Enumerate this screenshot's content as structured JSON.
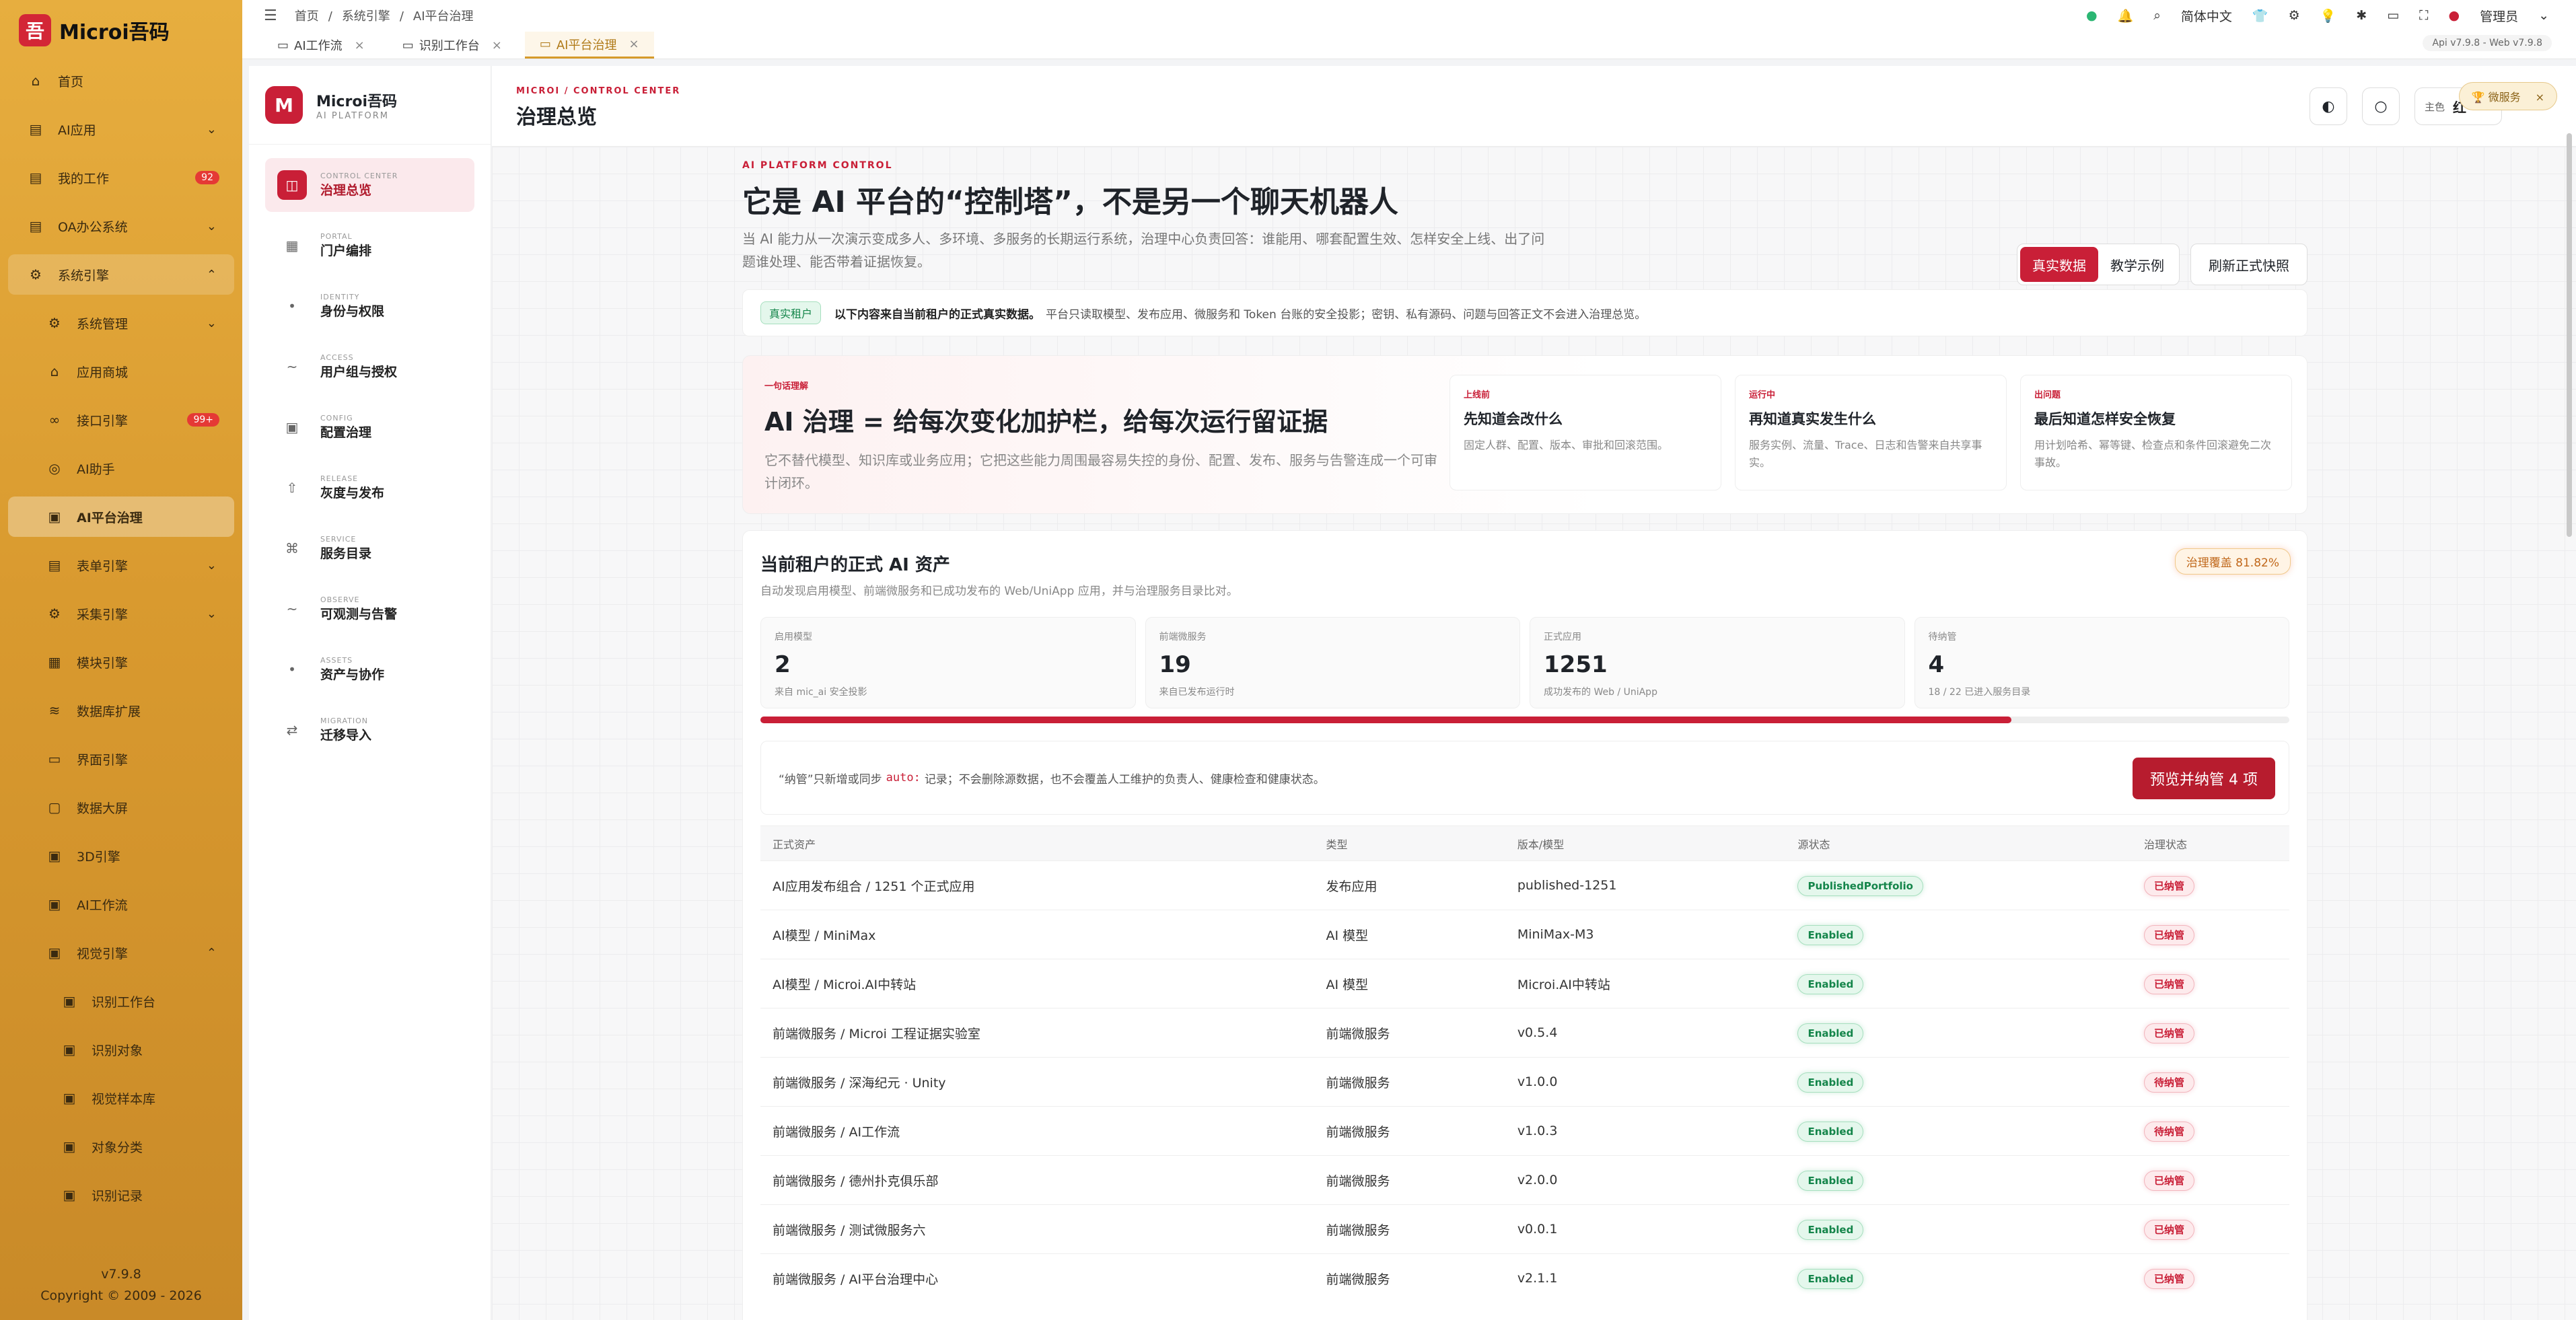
{
  "app": {
    "name": "Microi吾码",
    "version": "v7.9.8",
    "copyright": "Copyright © 2009 - 2026"
  },
  "sidebar": {
    "items": [
      {
        "label": "首页",
        "icon": "home-icon"
      },
      {
        "label": "AI应用",
        "icon": "doc-icon",
        "chevron": "⌄"
      },
      {
        "label": "我的工作",
        "icon": "doc-icon",
        "badge": "92"
      },
      {
        "label": "OA办公系统",
        "icon": "doc-icon",
        "chevron": "⌄"
      },
      {
        "label": "系统引擎",
        "icon": "gear-icon",
        "chevron": "⌃"
      },
      {
        "label": "系统管理",
        "icon": "gear-icon",
        "chevron": "⌄"
      },
      {
        "label": "应用商城",
        "icon": "home-icon"
      },
      {
        "label": "接口引擎",
        "icon": "link-icon",
        "badge": "99+"
      },
      {
        "label": "AI助手",
        "icon": "ai-icon"
      },
      {
        "label": "AI平台治理",
        "icon": "clipboard-icon"
      },
      {
        "label": "表单引擎",
        "icon": "doc-icon",
        "chevron": "⌄"
      },
      {
        "label": "采集引擎",
        "icon": "gear-icon",
        "chevron": "⌄"
      },
      {
        "label": "模块引擎",
        "icon": "grid-icon"
      },
      {
        "label": "数据库扩展",
        "icon": "database-icon"
      },
      {
        "label": "界面引擎",
        "icon": "layout-icon"
      },
      {
        "label": "数据大屏",
        "icon": "monitor-icon"
      },
      {
        "label": "3D引擎",
        "icon": "clipboard-icon"
      },
      {
        "label": "AI工作流",
        "icon": "clipboard-icon"
      },
      {
        "label": "视觉引擎",
        "icon": "clipboard-icon",
        "chevron": "⌃"
      },
      {
        "label": "识别工作台",
        "icon": "clipboard-icon"
      },
      {
        "label": "识别对象",
        "icon": "clipboard-icon"
      },
      {
        "label": "视觉样本库",
        "icon": "clipboard-icon"
      },
      {
        "label": "对象分类",
        "icon": "clipboard-icon"
      },
      {
        "label": "识别记录",
        "icon": "clipboard-icon"
      }
    ]
  },
  "topbar": {
    "breadcrumb": [
      "首页",
      "/",
      "系统引擎",
      "/",
      "AI平台治理"
    ],
    "lang": "简体中文",
    "user": "管理员",
    "version_pill": "Api v7.9.8 - Web v7.9.8"
  },
  "tabs": [
    {
      "label": "AI工作流",
      "close": "×"
    },
    {
      "label": "识别工作台",
      "close": "×"
    },
    {
      "label": "AI平台治理",
      "close": "×"
    }
  ],
  "gov_nav": {
    "brand": "Microi吾码",
    "brand_sub": "AI PLATFORM",
    "items": [
      {
        "en": "CONTROL CENTER",
        "cn": "治理总览",
        "icon": "panel-icon"
      },
      {
        "en": "PORTAL",
        "cn": "门户编排",
        "icon": "grid-icon"
      },
      {
        "en": "IDENTITY",
        "cn": "身份与权限",
        "icon": "dot-icon"
      },
      {
        "en": "ACCESS",
        "cn": "用户组与授权",
        "icon": "tilde-icon"
      },
      {
        "en": "CONFIG",
        "cn": "配置治理",
        "icon": "square-icon"
      },
      {
        "en": "RELEASE",
        "cn": "灰度与发布",
        "icon": "upload-icon"
      },
      {
        "en": "SERVICE",
        "cn": "服务目录",
        "icon": "command-icon"
      },
      {
        "en": "OBSERVE",
        "cn": "可观测与告警",
        "icon": "tilde-icon"
      },
      {
        "en": "ASSETS",
        "cn": "资产与协作",
        "icon": "dot-icon"
      },
      {
        "en": "MIGRATION",
        "cn": "迁移导入",
        "icon": "swap-icon"
      }
    ]
  },
  "control": {
    "eyebrow": "MICROI / CONTROL CENTER",
    "title": "治理总览",
    "theme_label": "主色",
    "theme_value": "红",
    "service_chip": "微服务"
  },
  "hero": {
    "eyebrow": "AI PLATFORM CONTROL",
    "title": "它是 AI 平台的“控制塔”，不是另一个聊天机器人",
    "desc": "当 AI 能力从一次演示变成多人、多环境、多服务的长期运行系统，治理中心负责回答：谁能用、哪套配置生效、怎样安全上线、出了问题谁处理、能否带着证据恢复。",
    "seg_real": "真实数据",
    "seg_demo": "教学示例",
    "refresh": "刷新正式快照"
  },
  "notice": {
    "tag": "真实租户",
    "bold": "以下内容来自当前租户的正式真实数据。",
    "text": "平台只读取模型、发布应用、微服务和 Token 台账的安全投影；密钥、私有源码、问题与回答正文不会进入治理总览。"
  },
  "principle": {
    "eyebrow": "一句话理解",
    "title": "AI 治理 = 给每次变化加护栏，给每次运行留证据",
    "desc": "它不替代模型、知识库或业务应用；它把这些能力周围最容易失控的身份、配置、发布、服务与告警连成一个可审计闭环。",
    "cards": [
      {
        "k": "上线前",
        "t": "先知道会改什么",
        "d": "固定人群、配置、版本、审批和回滚范围。"
      },
      {
        "k": "运行中",
        "t": "再知道真实发生什么",
        "d": "服务实例、流量、Trace、日志和告警来自共享事实。"
      },
      {
        "k": "出问题",
        "t": "最后知道怎样安全恢复",
        "d": "用计划哈希、幂等键、检查点和条件回滚避免二次事故。"
      }
    ]
  },
  "assets": {
    "title": "当前租户的正式 AI 资产",
    "sub": "自动发现启用模型、前端微服务和已成功发布的 Web/UniApp 应用，并与治理服务目录比对。",
    "coverage": "治理覆盖 81.82%",
    "coverage_ratio": 0.8182,
    "stats": [
      {
        "l": "启用模型",
        "v": "2",
        "s": "来自 mic_ai 安全投影"
      },
      {
        "l": "前端微服务",
        "v": "19",
        "s": "来自已发布运行时"
      },
      {
        "l": "正式应用",
        "v": "1251",
        "s": "成功发布的 Web / UniApp"
      },
      {
        "l": "待纳管",
        "v": "4",
        "s": "18 / 22 已进入服务目录"
      }
    ],
    "import_pre": "“纳管”只新增或同步",
    "import_code": "auto:",
    "import_post": "记录；不会删除源数据，也不会覆盖人工维护的负责人、健康检查和健康状态。",
    "import_btn": "预览并纳管 4 项",
    "columns": [
      "正式资产",
      "类型",
      "版本/模型",
      "源状态",
      "治理状态"
    ],
    "rows": [
      {
        "asset": "AI应用发布组合 / 1251 个正式应用",
        "type": "发布应用",
        "ver": "published-1251",
        "src": "PublishedPortfolio",
        "gov": "已纳管"
      },
      {
        "asset": "AI模型 / MiniMax",
        "type": "AI 模型",
        "ver": "MiniMax-M3",
        "src": "Enabled",
        "gov": "已纳管"
      },
      {
        "asset": "AI模型 / Microi.AI中转站",
        "type": "AI 模型",
        "ver": "Microi.AI中转站",
        "src": "Enabled",
        "gov": "已纳管"
      },
      {
        "asset": "前端微服务 / Microi 工程证据实验室",
        "type": "前端微服务",
        "ver": "v0.5.4",
        "src": "Enabled",
        "gov": "已纳管"
      },
      {
        "asset": "前端微服务 / 深海纪元 · Unity",
        "type": "前端微服务",
        "ver": "v1.0.0",
        "src": "Enabled",
        "gov": "待纳管"
      },
      {
        "asset": "前端微服务 / AI工作流",
        "type": "前端微服务",
        "ver": "v1.0.3",
        "src": "Enabled",
        "gov": "待纳管"
      },
      {
        "asset": "前端微服务 / 德州扑克俱乐部",
        "type": "前端微服务",
        "ver": "v2.0.0",
        "src": "Enabled",
        "gov": "已纳管"
      },
      {
        "asset": "前端微服务 / 测试微服务六",
        "type": "前端微服务",
        "ver": "v0.0.1",
        "src": "Enabled",
        "gov": "已纳管"
      },
      {
        "asset": "前端微服务 / AI平台治理中心",
        "type": "前端微服务",
        "ver": "v2.1.1",
        "src": "Enabled",
        "gov": "已纳管"
      }
    ]
  }
}
